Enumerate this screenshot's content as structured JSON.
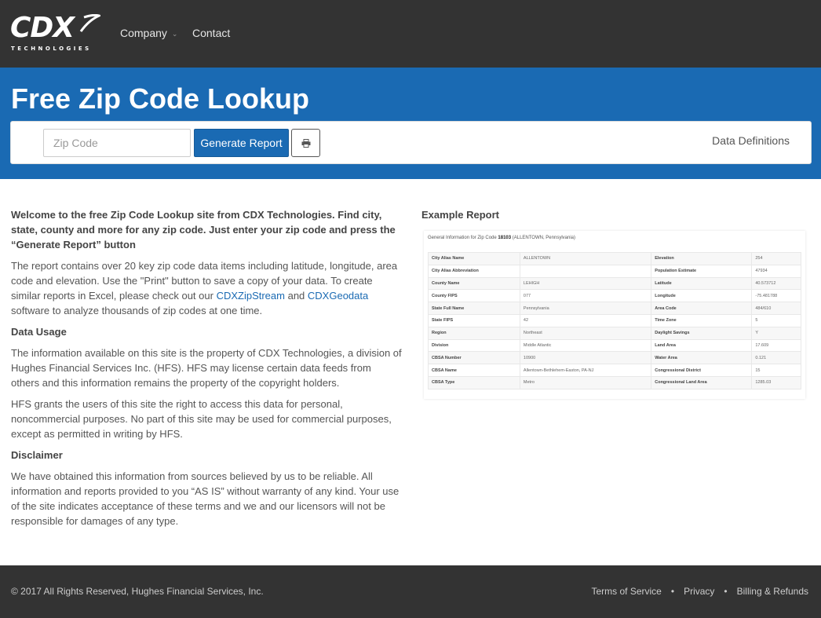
{
  "nav": {
    "logo_text": "CDX",
    "logo_sub": "TECHNOLOGIES",
    "items": [
      {
        "label": "Company"
      },
      {
        "label": "Contact"
      }
    ]
  },
  "hero": {
    "title": "Free Zip Code Lookup",
    "zip_placeholder": "Zip Code",
    "generate_label": "Generate Report",
    "data_definitions": "Data Definitions"
  },
  "content": {
    "intro": "Welcome to the free Zip Code Lookup site from CDX Technologies. Find city, state, county and more for any zip code. Just enter your zip code and press the “Generate Report” button",
    "p1_a": "The report contains over 20 key zip code data items including latitude, longitude, area code and elevation. Use the \"Print\" button to save a copy of your data. To create similar reports in Excel, please check out our ",
    "p1_link1": "CDXZipStream",
    "p1_and": " and ",
    "p1_link2": "CDXGeodata",
    "p1_b": " software to analyze thousands of zip codes at one time.",
    "data_usage_heading": "Data Usage",
    "p2": "The information available on this site is the property of CDX Technologies, a division of Hughes Financial Services Inc. (HFS). HFS may license certain data feeds from others and this information remains the property of the copyright holders.",
    "p3": "HFS grants the users of this site the right to access this data for personal, noncommercial purposes. No part of this site may be used for commercial purposes, except as permitted in writing by HFS.",
    "disclaimer_heading": "Disclaimer",
    "p4": "We have obtained this information from sources believed by us to be reliable. All information and reports provided to you “AS IS” without warranty of any kind. Your use of the site indicates acceptance of these terms and we and our licensors will not be responsible for damages of any type."
  },
  "example": {
    "title": "Example Report",
    "head_prefix": "General Information for Zip Code ",
    "zip": "18103",
    "head_suffix": " (ALLENTOWN, Pennsylvania)",
    "rows": [
      [
        "City Alias Name",
        "ALLENTOWN",
        "Elevation",
        "254"
      ],
      [
        "City Alias Abbreviation",
        "",
        "Population Estimate",
        "47934"
      ],
      [
        "County Name",
        "LEHIGH",
        "Latitude",
        "40.573712"
      ],
      [
        "County FIPS",
        "077",
        "Longitude",
        "-75.481788"
      ],
      [
        "State Full Name",
        "Pennsylvania",
        "Area Code",
        "484/610"
      ],
      [
        "State FIPS",
        "42",
        "Time Zone",
        "5"
      ],
      [
        "Region",
        "Northeast",
        "Daylight Savings",
        "Y"
      ],
      [
        "Division",
        "Middle Atlantic",
        "Land Area",
        "17.609"
      ],
      [
        "CBSA Number",
        "10900",
        "Water Area",
        "0.121"
      ],
      [
        "CBSA Name",
        "Allentown-Bethlehem-Easton, PA-NJ",
        "Congressional District",
        "15"
      ],
      [
        "CBSA Type",
        "Metro",
        "Congressional Land Area",
        "1285.03"
      ]
    ]
  },
  "footer": {
    "copyright": "© 2017 All Rights Reserved, Hughes Financial Services, Inc.",
    "links": [
      "Terms of Service",
      "Privacy",
      "Billing & Refunds"
    ],
    "separator": "•"
  }
}
